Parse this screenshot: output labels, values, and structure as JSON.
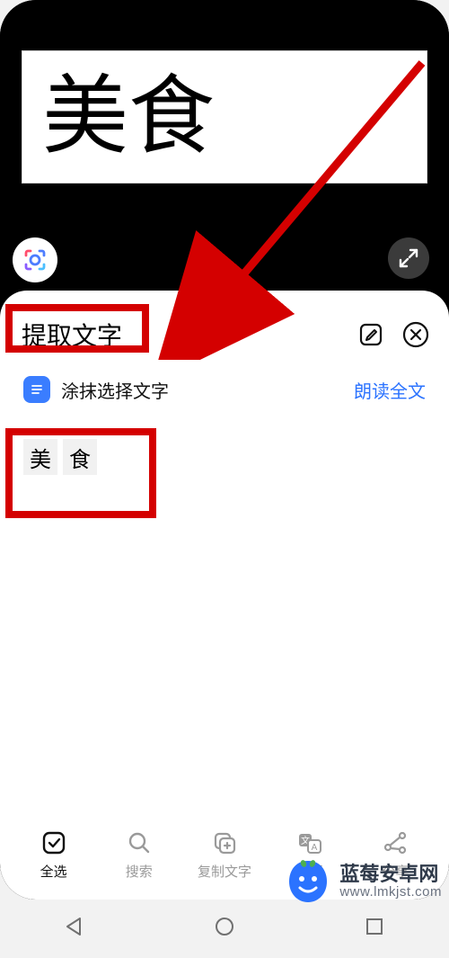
{
  "scanned_text": "美食",
  "sheet": {
    "title": "提取文字",
    "select_label": "涂抹选择文字",
    "read_aloud": "朗读全文",
    "result_chars": [
      "美",
      "食"
    ]
  },
  "toolbar": {
    "select_all": "全选",
    "search": "搜索",
    "copy": "复制文字",
    "translate": "翻译",
    "share": "分享"
  },
  "watermark": {
    "title": "蓝莓安卓网",
    "subtitle": "www.lmkjst.com"
  },
  "colors": {
    "highlight": "#d40000",
    "link_blue": "#2b73ff",
    "badge_blue": "#3a7dff"
  }
}
